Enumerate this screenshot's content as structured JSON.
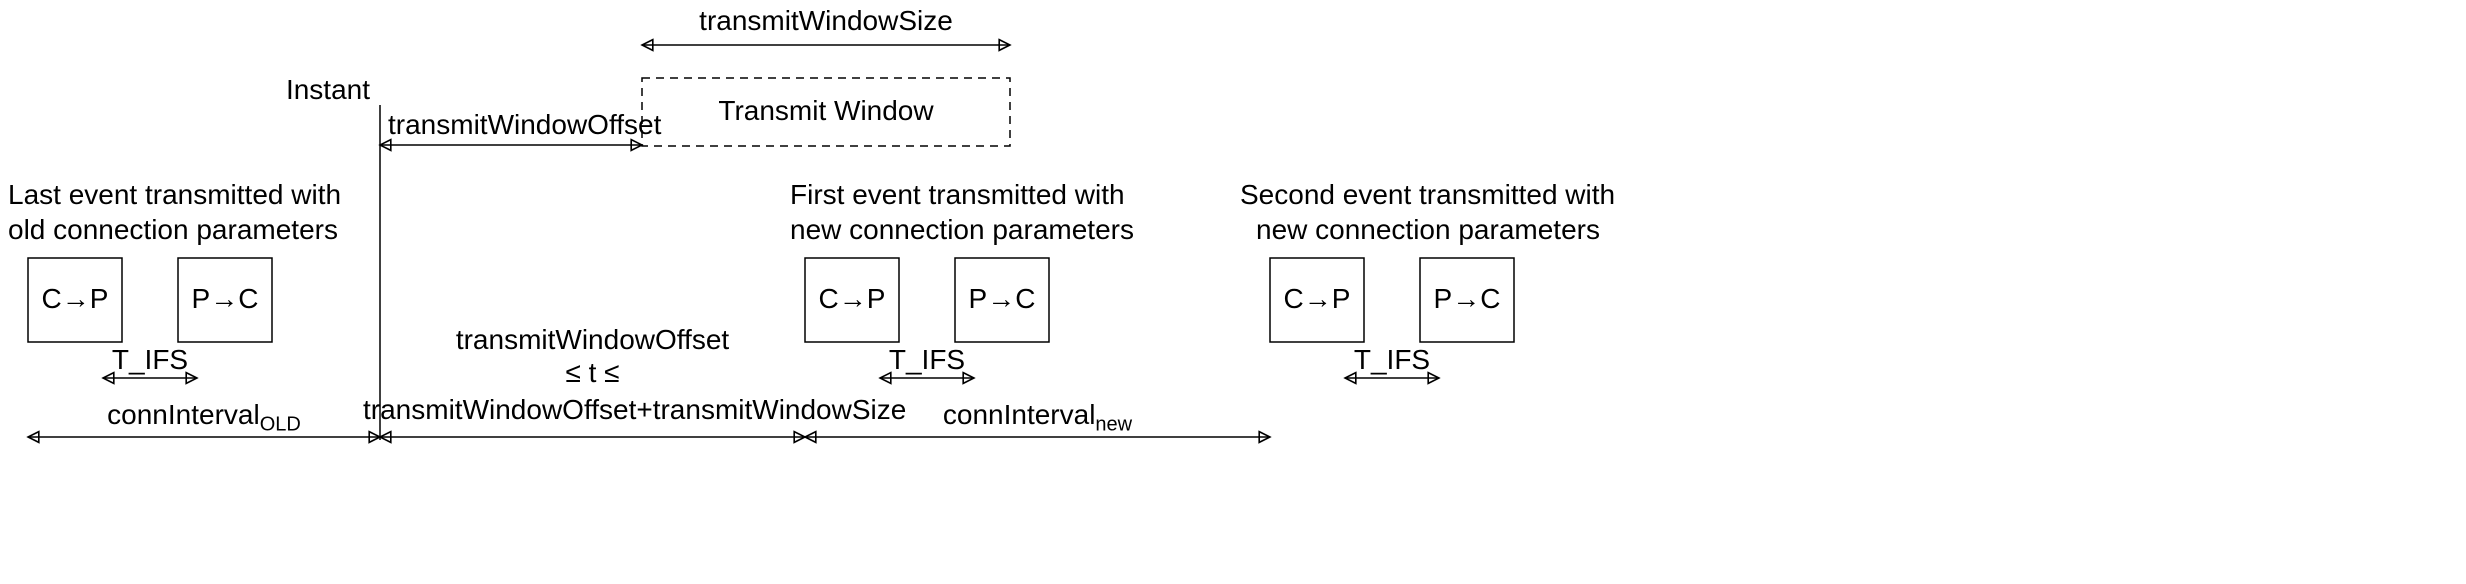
{
  "labels": {
    "transmitWindowSize": "transmitWindowSize",
    "instant": "Instant",
    "transmitWindow": "Transmit Window",
    "transmitWindowOffset": "transmitWindowOffset",
    "oldCaption1": "Last event transmitted with",
    "oldCaption2": "old connection parameters",
    "firstCaption1": "First event transmitted with",
    "firstCaption2": "new connection parameters",
    "secondCaption1": "Second event transmitted with",
    "secondCaption2": "new connection parameters",
    "CtoP": "C→P",
    "PtoC": "P→C",
    "T_IFS": "T_IFS",
    "midLine1": "transmitWindowOffset",
    "midLine2": "≤ t ≤",
    "midLine3": "transmitWindowOffset+transmitWindowSize",
    "connIntervalOld_main": "connInterval",
    "connIntervalOld_sub": "OLD",
    "connIntervalNew_main": "connInterval",
    "connIntervalNew_sub": "new"
  }
}
